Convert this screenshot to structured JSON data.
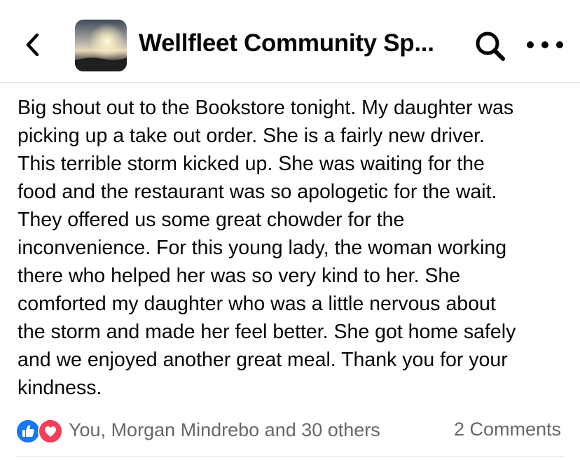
{
  "header": {
    "back_icon": "chevron-left-icon",
    "group_name": "Wellfleet Community Sp...",
    "avatar_image": "sunset-over-water",
    "search_icon": "search-icon",
    "more_icon": "more-dots-icon"
  },
  "post": {
    "lines": [
      "Big shout out to the Bookstore tonight. My daughter was",
      "picking up a take out order. She is a fairly new driver.",
      "This terrible storm kicked up. She was waiting for the",
      "food and the restaurant was so apologetic for the wait.",
      "They offered us some great chowder for the",
      "inconvenience. For this young lady, the woman working",
      "there who helped her was so very kind to her. She",
      "comforted my daughter who was a little nervous about",
      "the storm and made her feel better. She got home safely",
      "and we enjoyed another great meal. Thank you for your",
      "kindness."
    ]
  },
  "footer": {
    "reactions_text": "You, Morgan Mindrebo and 30 others",
    "comments_text": "2 Comments",
    "reaction_icons": [
      "like-icon",
      "love-icon"
    ]
  },
  "colors": {
    "like": "#1877f2",
    "love": "#f33e58",
    "secondary_text": "#65676b",
    "divider": "#dadde1"
  }
}
